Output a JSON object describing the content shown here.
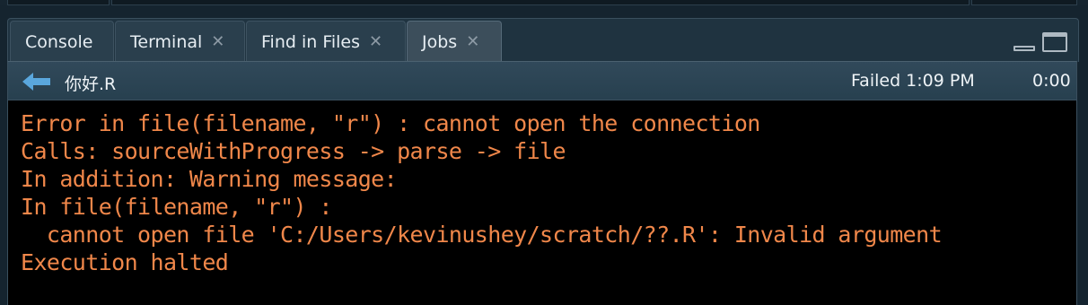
{
  "tabs": [
    {
      "label": "Console",
      "closable": false,
      "active": false
    },
    {
      "label": "Terminal",
      "closable": true,
      "active": false
    },
    {
      "label": "Find in Files",
      "closable": true,
      "active": false
    },
    {
      "label": "Jobs",
      "closable": true,
      "active": true
    }
  ],
  "tab_close_glyph": "✕",
  "job": {
    "name": "你好.R",
    "status": "Failed 1:09 PM",
    "elapsed": "0:00"
  },
  "output": {
    "lines": [
      "Error in file(filename, \"r\") : cannot open the connection",
      "Calls: sourceWithProgress -> parse -> file",
      "In addition: Warning message:",
      "In file(filename, \"r\") :",
      "  cannot open file 'C:/Users/kevinushey/scratch/??.R': Invalid argument",
      "Execution halted"
    ],
    "color": "#f0874a"
  },
  "colors": {
    "background": "#15242f",
    "console_bg": "#000000",
    "accent_icon": "#5aa7dd"
  },
  "icons": {
    "back": "arrow-left-icon",
    "minimize": "minimize-icon",
    "maximize": "maximize-icon"
  }
}
